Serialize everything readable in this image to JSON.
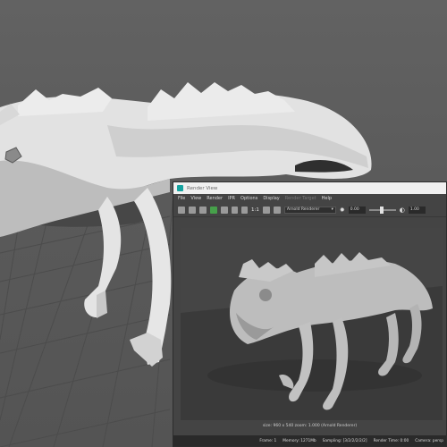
{
  "render_view": {
    "title": "Render View",
    "menu": [
      "File",
      "View",
      "Render",
      "IPR",
      "Options",
      "Display",
      "Render Target",
      "Help"
    ],
    "disabled_menu_item": "Render Target",
    "toolbar": {
      "ratio_label": "1:1",
      "renderer": "Arnold Renderer",
      "exposure_value": "0.00",
      "gamma_value": "1.00"
    },
    "size_line": "size: 960 x 540  zoom: 1.000      (Arnold Renderer)",
    "status": {
      "frame": "Frame: 1",
      "memory": "Memory: 1271Mb",
      "sampling": "Sampling: [3/2/2/2/2/2]",
      "render_time": "Render Time: 0:00",
      "camera": "Camera: persp"
    },
    "icons": [
      "render-icon",
      "ipr-icon",
      "snapshot-icon",
      "refresh-icon",
      "region-icon",
      "rgb-icon",
      "keep-image-icon",
      "color-management-icon"
    ]
  },
  "colors": {
    "viewport_bg": "#5c5c5c",
    "render_bg": "#444444",
    "accent_green": "#46a04a"
  }
}
